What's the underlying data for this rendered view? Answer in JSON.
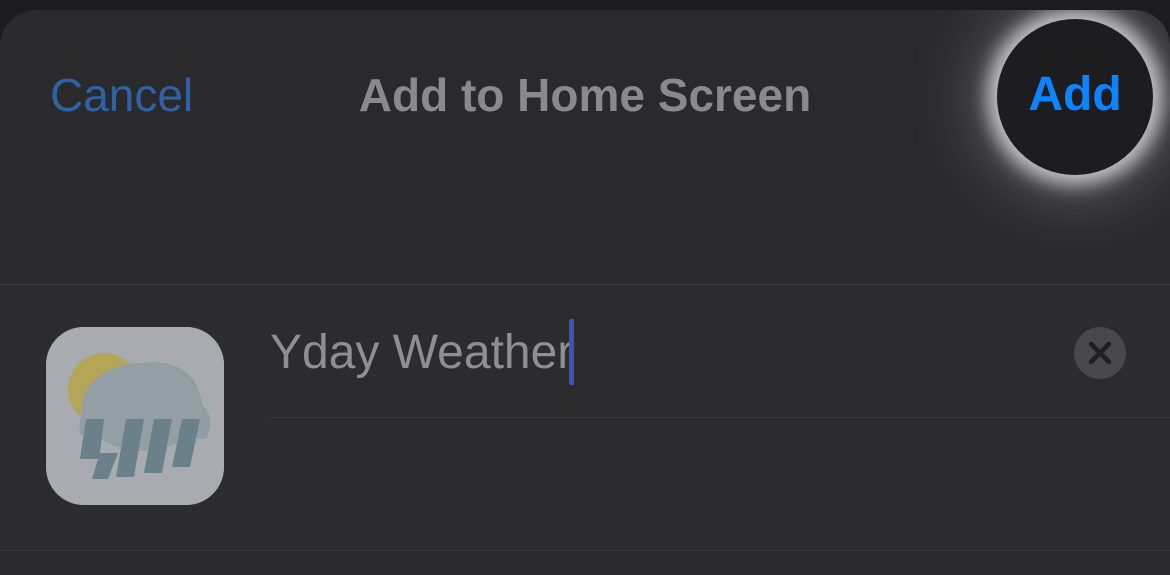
{
  "nav": {
    "cancel_label": "Cancel",
    "title": "Add to Home Screen",
    "add_label": "Add"
  },
  "form": {
    "app_name_value": "Yday Weather",
    "app_icon": "weather-app-icon",
    "clear_icon": "clear-text-icon"
  },
  "colors": {
    "accent": "#0a84ff",
    "cancel": "#2f62a3",
    "sheet_background": "#2a2a2c",
    "cursor": "#3b54b8"
  }
}
